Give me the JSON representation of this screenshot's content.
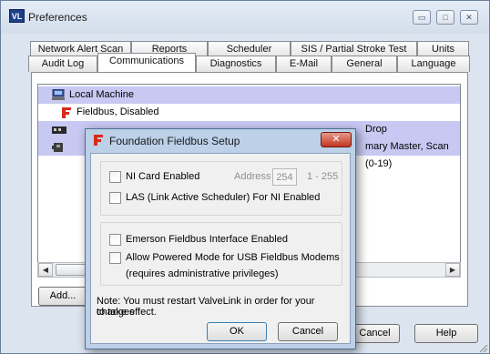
{
  "window": {
    "title": "Preferences",
    "app_icon_text": "VL",
    "minimize": "▭",
    "maximize": "□",
    "close": "✕"
  },
  "tabs_row1": [
    "Network Alert Scan",
    "Reports",
    "Scheduler",
    "SIS / Partial Stroke Test",
    "Units"
  ],
  "tabs_row2": [
    "Audit Log",
    "Communications",
    "Diagnostics",
    "E-Mail",
    "General",
    "Language"
  ],
  "active_tab": "Communications",
  "tree": {
    "root": "Local Machine",
    "items": [
      {
        "label": "Fieldbus, Disabled",
        "icon": "fieldbus-icon"
      },
      {
        "label": "Drop",
        "icon": "hart-modem-icon"
      },
      {
        "label": "mary Master, Scan (0-19)",
        "icon": "network-icon"
      }
    ]
  },
  "buttons": {
    "add": "Add...",
    "cancel": "Cancel",
    "help": "Help"
  },
  "dialog": {
    "title": "Foundation Fieldbus Setup",
    "close": "✕",
    "ni_card_label": "NI Card Enabled",
    "address_label": "Address",
    "address_value": "254",
    "address_range": "1 - 255",
    "las_label": "LAS (Link Active Scheduler) For NI Enabled",
    "emerson_label": "Emerson Fieldbus Interface Enabled",
    "usb_label": "Allow Powered Mode for USB Fieldbus Modems",
    "usb_sub": "(requires administrative privileges)",
    "note_line1": "Note:  You must restart ValveLink in order for your changes",
    "note_line2": "to take effect.",
    "ok": "OK",
    "cancel": "Cancel"
  },
  "colors": {
    "selection_band": "#c7c9f3",
    "dialog_frame": "#bcd0e8",
    "close_red": "#c2351f"
  }
}
